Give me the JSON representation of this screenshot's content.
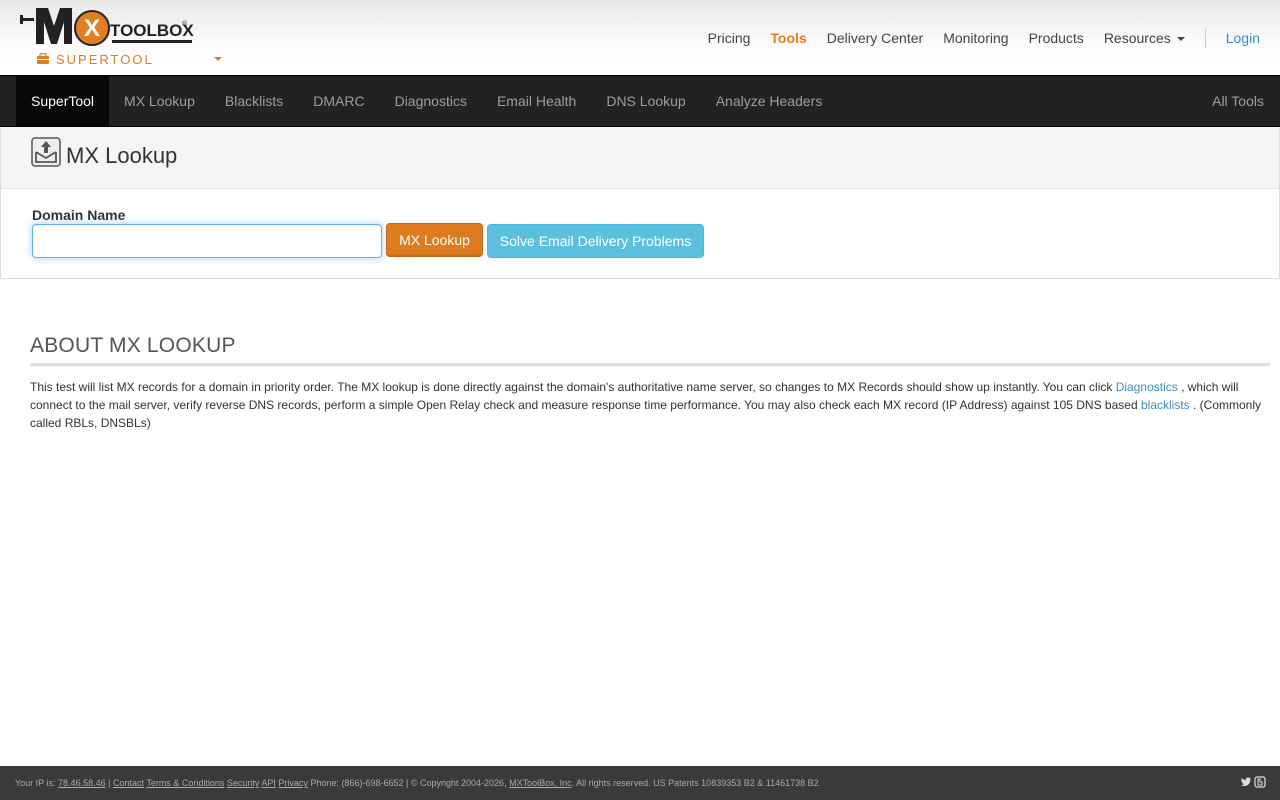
{
  "header": {
    "logo_text": "MX TOOLBOX",
    "product_switch_label": "SUPERTOOL",
    "nav": {
      "pricing": "Pricing",
      "tools": "Tools",
      "delivery_center": "Delivery Center",
      "monitoring": "Monitoring",
      "products": "Products",
      "resources": "Resources",
      "login": "Login"
    }
  },
  "toolnav": {
    "items": [
      "SuperTool",
      "MX Lookup",
      "Blacklists",
      "DMARC",
      "Diagnostics",
      "Email Health",
      "DNS Lookup",
      "Analyze Headers"
    ],
    "active_index": 0,
    "all_tools": "All Tools"
  },
  "panel": {
    "title": "MX Lookup",
    "title_icon": "envelope-upload-icon",
    "domain_label": "Domain Name",
    "domain_value": "",
    "domain_placeholder": "",
    "lookup_button": "MX Lookup",
    "solve_button": "Solve Email Delivery Problems"
  },
  "about": {
    "heading": "ABOUT MX LOOKUP",
    "text_part1": "This test will list MX records for a domain in priority order. The MX lookup is done directly against the domain's authoritative name server, so changes to MX Records should show up instantly. You can click",
    "link_diagnostics": "Diagnostics",
    "text_part2": ", which will connect to the mail server, verify reverse DNS records, perform a simple Open Relay check and measure response time performance. You may also check each MX record (IP Address) against 105 DNS based",
    "link_blacklists": "blacklists",
    "text_part3": ". (Commonly called RBLs, DNSBLs)"
  },
  "footer": {
    "ip_label": "Your IP is:",
    "ip": "78.46.58.46",
    "contact": "Contact",
    "terms": "Terms & Conditions",
    "security": "Security",
    "api": "API",
    "privacy": "Privacy",
    "phone": "Phone: (866)-698-6652",
    "copyright": "© Copyright 2004-2026,",
    "company": "MXToolBox, Inc",
    "rights": ". All rights reserved. US Patents 10839353 B2 & 11461738 B2",
    "icons": [
      "twitter-icon",
      "blog-icon"
    ]
  },
  "colors": {
    "accent_orange": "#e07f22",
    "nav_dark": "#222222",
    "info_blue": "#5bc0de",
    "link_blue": "#3c8dbc"
  }
}
